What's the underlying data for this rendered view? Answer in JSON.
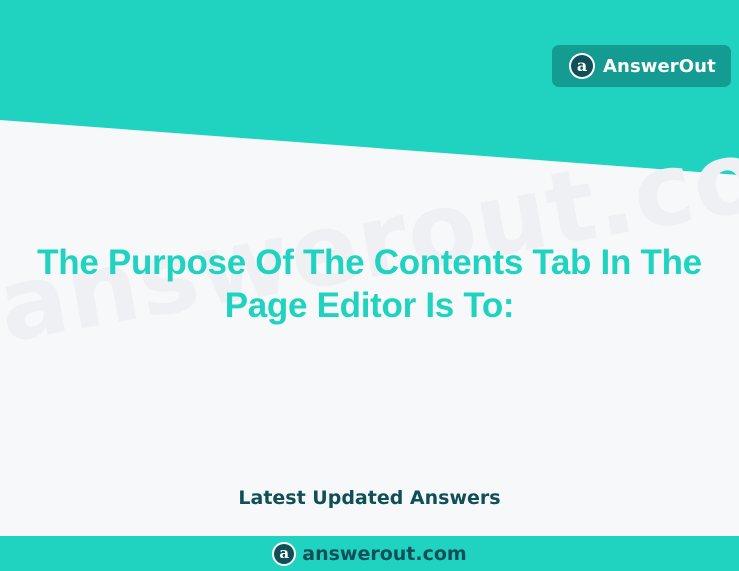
{
  "header": {
    "brand_name": "AnswerOut",
    "logo_icon": "answerout-logo-icon"
  },
  "watermark": {
    "text": "answerout.com"
  },
  "main": {
    "title": "The Purpose Of The Contents Tab In The Page Editor Is To:",
    "subtitle": "Latest Updated Answers"
  },
  "footer": {
    "site": "answerout.com",
    "logo_icon": "answerout-logo-icon"
  },
  "colors": {
    "accent": "#1fd3c0",
    "badge": "#149c93",
    "dark": "#0f4f57",
    "background": "#f7f8fa"
  }
}
